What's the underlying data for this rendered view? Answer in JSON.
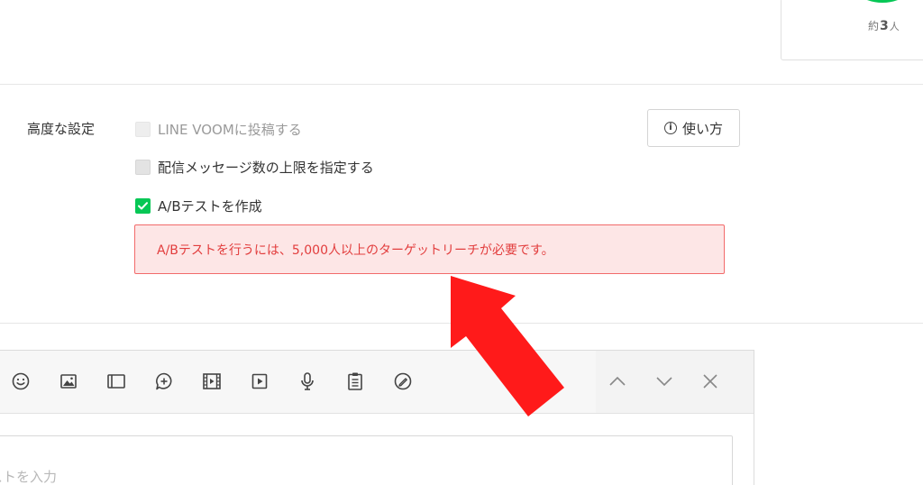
{
  "reach": {
    "prefix": "約",
    "count": "3",
    "unit": "人",
    "ring_color": "#06c755"
  },
  "advanced": {
    "label": "高度な設定",
    "options": [
      {
        "label": "LINE VOOMに投稿する",
        "state": "disabled"
      },
      {
        "label": "配信メッセージ数の上限を指定する",
        "state": "unchecked"
      },
      {
        "label": "A/Bテストを作成",
        "state": "checked"
      }
    ],
    "help_button": "使い方",
    "alert": "A/Bテストを行うには、5,000人以上のターゲットリーチが必要です。",
    "alert_color": "#e23d3d",
    "check_color": "#06c755"
  },
  "editor": {
    "toolbar_icons": [
      "emoji-icon",
      "image-icon",
      "card-icon",
      "chat-bubble-plus-icon",
      "video-icon",
      "play-icon",
      "microphone-icon",
      "clipboard-icon",
      "sticker-icon"
    ],
    "nav_icons": [
      "chevron-up-icon",
      "chevron-down-icon",
      "close-icon"
    ],
    "input_placeholder": "ストを入力",
    "input_value": ""
  },
  "annotation": {
    "arrow_color": "#ff1a1a"
  }
}
